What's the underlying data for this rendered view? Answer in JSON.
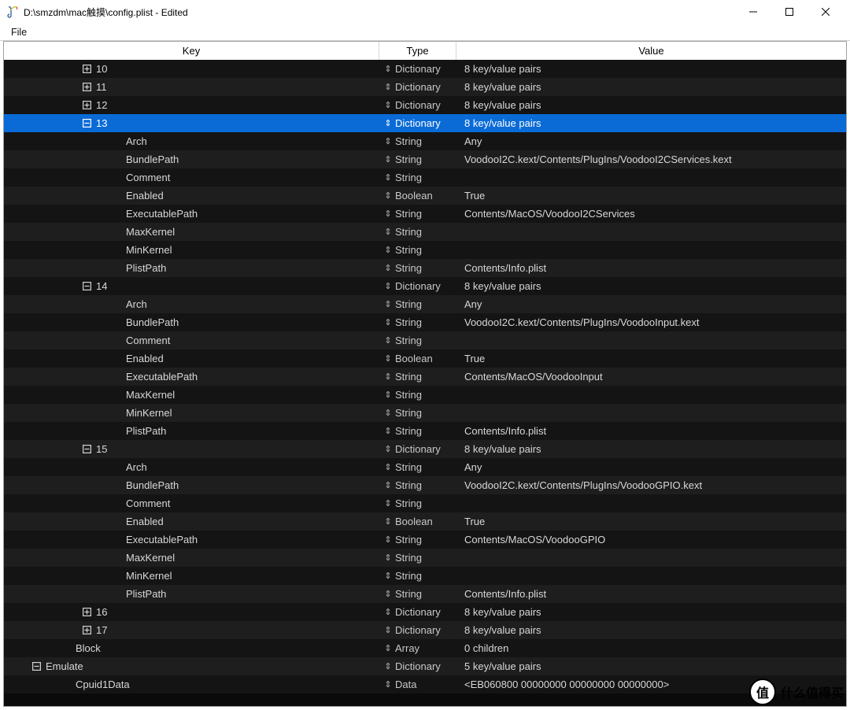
{
  "window": {
    "title": "D:\\smzdm\\mac触摸\\config.plist - Edited"
  },
  "menu": {
    "file": "File"
  },
  "headers": {
    "key": "Key",
    "type": "Type",
    "value": "Value"
  },
  "watermark": {
    "badge": "值",
    "text": "什么值得买"
  },
  "rows": [
    {
      "depth": 3,
      "exp": "plus",
      "key": "10",
      "type": "Dictionary",
      "value": "8 key/value pairs",
      "sel": false
    },
    {
      "depth": 3,
      "exp": "plus",
      "key": "11",
      "type": "Dictionary",
      "value": "8 key/value pairs",
      "sel": false
    },
    {
      "depth": 3,
      "exp": "plus",
      "key": "12",
      "type": "Dictionary",
      "value": "8 key/value pairs",
      "sel": false
    },
    {
      "depth": 3,
      "exp": "minus",
      "key": "13",
      "type": "Dictionary",
      "value": "8 key/value pairs",
      "sel": true
    },
    {
      "depth": 4,
      "exp": "none",
      "key": "Arch",
      "type": "String",
      "value": "Any",
      "sel": false
    },
    {
      "depth": 4,
      "exp": "none",
      "key": "BundlePath",
      "type": "String",
      "value": "VoodooI2C.kext/Contents/PlugIns/VoodooI2CServices.kext",
      "sel": false
    },
    {
      "depth": 4,
      "exp": "none",
      "key": "Comment",
      "type": "String",
      "value": "",
      "sel": false
    },
    {
      "depth": 4,
      "exp": "none",
      "key": "Enabled",
      "type": "Boolean",
      "value": "True",
      "sel": false
    },
    {
      "depth": 4,
      "exp": "none",
      "key": "ExecutablePath",
      "type": "String",
      "value": "Contents/MacOS/VoodooI2CServices",
      "sel": false
    },
    {
      "depth": 4,
      "exp": "none",
      "key": "MaxKernel",
      "type": "String",
      "value": "",
      "sel": false
    },
    {
      "depth": 4,
      "exp": "none",
      "key": "MinKernel",
      "type": "String",
      "value": "",
      "sel": false
    },
    {
      "depth": 4,
      "exp": "none",
      "key": "PlistPath",
      "type": "String",
      "value": "Contents/Info.plist",
      "sel": false
    },
    {
      "depth": 3,
      "exp": "minus",
      "key": "14",
      "type": "Dictionary",
      "value": "8 key/value pairs",
      "sel": false
    },
    {
      "depth": 4,
      "exp": "none",
      "key": "Arch",
      "type": "String",
      "value": "Any",
      "sel": false
    },
    {
      "depth": 4,
      "exp": "none",
      "key": "BundlePath",
      "type": "String",
      "value": "VoodooI2C.kext/Contents/PlugIns/VoodooInput.kext",
      "sel": false
    },
    {
      "depth": 4,
      "exp": "none",
      "key": "Comment",
      "type": "String",
      "value": "",
      "sel": false
    },
    {
      "depth": 4,
      "exp": "none",
      "key": "Enabled",
      "type": "Boolean",
      "value": "True",
      "sel": false
    },
    {
      "depth": 4,
      "exp": "none",
      "key": "ExecutablePath",
      "type": "String",
      "value": "Contents/MacOS/VoodooInput",
      "sel": false
    },
    {
      "depth": 4,
      "exp": "none",
      "key": "MaxKernel",
      "type": "String",
      "value": "",
      "sel": false
    },
    {
      "depth": 4,
      "exp": "none",
      "key": "MinKernel",
      "type": "String",
      "value": "",
      "sel": false
    },
    {
      "depth": 4,
      "exp": "none",
      "key": "PlistPath",
      "type": "String",
      "value": "Contents/Info.plist",
      "sel": false
    },
    {
      "depth": 3,
      "exp": "minus",
      "key": "15",
      "type": "Dictionary",
      "value": "8 key/value pairs",
      "sel": false
    },
    {
      "depth": 4,
      "exp": "none",
      "key": "Arch",
      "type": "String",
      "value": "Any",
      "sel": false
    },
    {
      "depth": 4,
      "exp": "none",
      "key": "BundlePath",
      "type": "String",
      "value": "VoodooI2C.kext/Contents/PlugIns/VoodooGPIO.kext",
      "sel": false
    },
    {
      "depth": 4,
      "exp": "none",
      "key": "Comment",
      "type": "String",
      "value": "",
      "sel": false
    },
    {
      "depth": 4,
      "exp": "none",
      "key": "Enabled",
      "type": "Boolean",
      "value": "True",
      "sel": false
    },
    {
      "depth": 4,
      "exp": "none",
      "key": "ExecutablePath",
      "type": "String",
      "value": "Contents/MacOS/VoodooGPIO",
      "sel": false
    },
    {
      "depth": 4,
      "exp": "none",
      "key": "MaxKernel",
      "type": "String",
      "value": "",
      "sel": false
    },
    {
      "depth": 4,
      "exp": "none",
      "key": "MinKernel",
      "type": "String",
      "value": "",
      "sel": false
    },
    {
      "depth": 4,
      "exp": "none",
      "key": "PlistPath",
      "type": "String",
      "value": "Contents/Info.plist",
      "sel": false
    },
    {
      "depth": 3,
      "exp": "plus",
      "key": "16",
      "type": "Dictionary",
      "value": "8 key/value pairs",
      "sel": false
    },
    {
      "depth": 3,
      "exp": "plus",
      "key": "17",
      "type": "Dictionary",
      "value": "8 key/value pairs",
      "sel": false
    },
    {
      "depth": 2,
      "exp": "none",
      "key": "Block",
      "type": "Array",
      "value": "0 children",
      "sel": false
    },
    {
      "depth": 1,
      "exp": "minus",
      "key": "Emulate",
      "type": "Dictionary",
      "value": "5 key/value pairs",
      "sel": false
    },
    {
      "depth": 2,
      "exp": "none",
      "key": "Cpuid1Data",
      "type": "Data",
      "value": "<EB060800 00000000 00000000 00000000>",
      "sel": false
    }
  ]
}
